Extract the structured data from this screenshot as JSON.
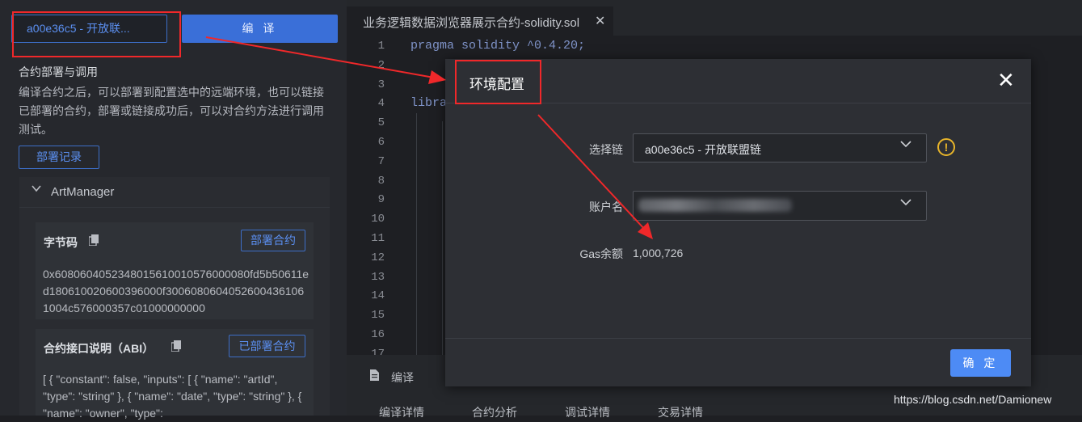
{
  "left_panel": {
    "chain_select_value": "a00e36c5 - 开放联...",
    "compile_button": "编 译",
    "section_title": "合约部署与调用",
    "section_desc": "编译合约之后，可以部署到配置选中的远端环境，也可以链接已部署的合约，部署或链接成功后，可以对合约方法进行调用测试。",
    "deploy_log_button": "部署记录",
    "contract_name": "ArtManager",
    "bytecode_title": "字节码",
    "deploy_contract_button": "部署合约",
    "bytecode_text": "0x6080604052348015610010576000080fd5b50611ed180610020600396000f30060806040526004361061004c576000357c01000000000",
    "abi_title": "合约接口说明（ABI）",
    "deployed_contract_button": "已部署合约",
    "abi_text": "[ { \"constant\": false, \"inputs\": [ { \"name\": \"artId\", \"type\": \"string\" }, { \"name\": \"date\", \"type\": \"string\" }, { \"name\": \"owner\", \"type\":"
  },
  "editor": {
    "file_tab": "业务逻辑数据浏览器展示合约-solidity.sol",
    "close_glyph": "✕",
    "line_numbers": [
      "1",
      "2",
      "3",
      "4",
      "5",
      "6",
      "7",
      "8",
      "9",
      "10",
      "11",
      "12",
      "13",
      "14",
      "15",
      "16",
      "17"
    ],
    "code_line1": "pragma solidity ^0.4.20;",
    "code_line4": "libra",
    "bottom_tab": "编译",
    "sub_tabs": [
      "编译详情",
      "合约分析",
      "调试详情",
      "交易详情"
    ]
  },
  "modal": {
    "title": "环境配置",
    "close_glyph": "✕",
    "chain_label": "选择链",
    "chain_value": "a00e36c5 - 开放联盟链",
    "warning_glyph": "!",
    "account_label": "账户名",
    "gas_label": "Gas余额",
    "gas_value": "1,000,726",
    "confirm_button": "确 定"
  },
  "watermark": "https://blog.csdn.net/Damionew",
  "colors": {
    "accent": "#4d8bf5",
    "annotation_red": "#f0282a",
    "warning": "#e8b52a"
  }
}
